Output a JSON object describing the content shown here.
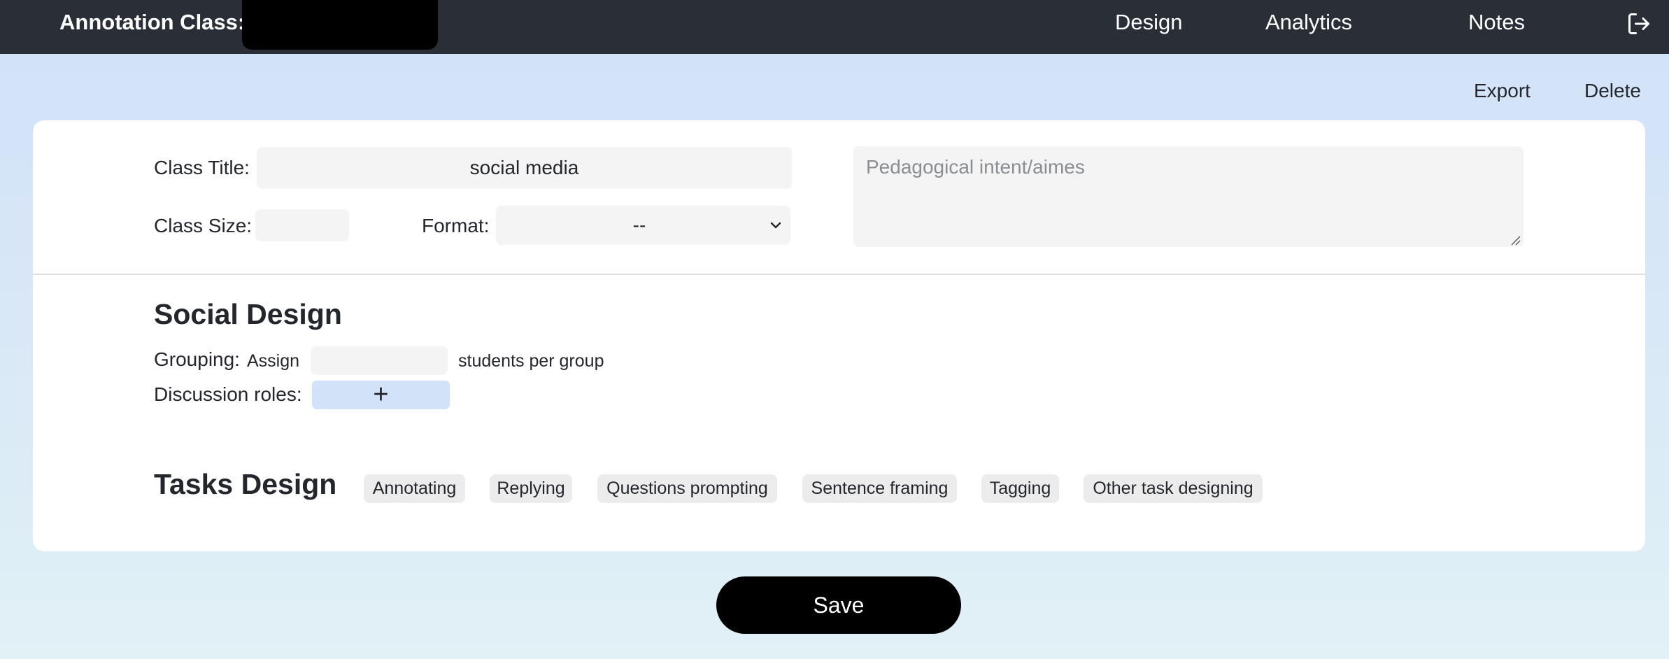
{
  "header": {
    "title": "Annotation Class:",
    "nav": {
      "design": "Design",
      "analytics": "Analytics",
      "notes": "Notes"
    },
    "logout_icon": "logout-icon"
  },
  "actions": {
    "export": "Export",
    "delete": "Delete"
  },
  "class_info": {
    "title_label": "Class Title:",
    "title_value": "social media",
    "size_label": "Class Size:",
    "size_value": "",
    "format_label": "Format:",
    "format_value": "--",
    "intent_placeholder": "Pedagogical intent/aimes",
    "intent_value": ""
  },
  "social_design": {
    "heading": "Social Design",
    "grouping_label": "Grouping:",
    "assign_label": "Assign",
    "group_size_value": "",
    "per_group_label": "students per group",
    "roles_label": "Discussion roles:",
    "add_role_symbol": "+"
  },
  "tasks_design": {
    "heading": "Tasks Design",
    "tasks": [
      "Annotating",
      "Replying",
      "Questions prompting",
      "Sentence framing",
      "Tagging",
      "Other task designing"
    ]
  },
  "save_label": "Save",
  "colors": {
    "topbar": "#2a2e36",
    "accent_light": "#d2e2f8",
    "save_button": "#000000"
  }
}
